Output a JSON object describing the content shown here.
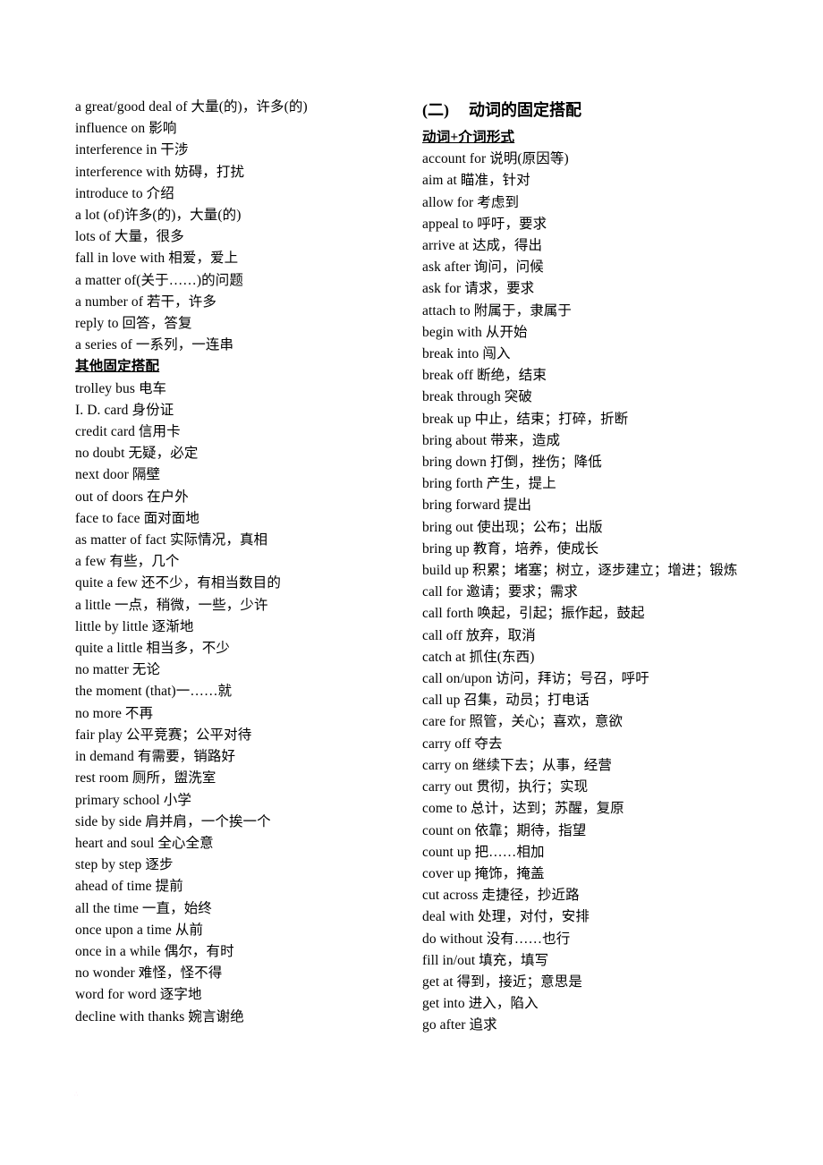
{
  "left_column": {
    "blocks": [
      {
        "type": "entries",
        "items": [
          "a great/good deal of 大量(的)，许多(的)",
          "influence on 影响",
          "interference in 干涉",
          "interference with 妨碍，打扰",
          "introduce to 介绍",
          "a lot (of)许多(的)，大量(的)",
          "lots of 大量，很多",
          "fall in love with 相爱，爱上",
          "a matter of(关于……)的问题",
          "a number of 若干，许多",
          "reply to 回答，答复",
          "a series of 一系列，一连串"
        ]
      },
      {
        "type": "section_head",
        "title": "其他固定搭配 "
      },
      {
        "type": "entries",
        "items": [
          "trolley bus 电车",
          "I. D. card 身份证",
          "credit card 信用卡",
          "no doubt 无疑，必定",
          "next door 隔壁",
          "out of doors 在户外",
          "face to face 面对面地",
          "as matter of fact 实际情况，真相",
          "a few 有些，几个",
          "quite a few 还不少，有相当数目的",
          "a little 一点，稍微，一些，少许",
          "little by little 逐渐地",
          "quite a little 相当多，不少",
          "no matter 无论",
          "the moment (that)一……就",
          "no more 不再",
          "fair play 公平竞赛；公平对待",
          "in demand 有需要，销路好",
          "rest room 厕所，盥洗室",
          "primary school 小学",
          "side by side 肩并肩，一个挨一个",
          "heart and soul 全心全意",
          "step by step 逐步",
          "ahead of time 提前",
          "all the time 一直，始终",
          "once upon a time 从前",
          "once in a while 偶尔，有时",
          "no wonder  难怪，怪不得",
          "word for word 逐字地",
          "decline with thanks 婉言谢绝"
        ]
      }
    ]
  },
  "right_column": {
    "chapter": {
      "number": "(二)",
      "title": "动词的固定搭配"
    },
    "blocks": [
      {
        "type": "section_head",
        "title": "动词+介词形式 "
      },
      {
        "type": "entries",
        "items": [
          "account for 说明(原因等)",
          "aim at 瞄准，针对",
          "allow for 考虑到",
          "appeal to 呼吁，要求",
          "arrive at 达成，得出",
          "ask after 询问，问候",
          "ask for 请求，要求",
          "attach to 附属于，隶属于",
          "begin with 从开始",
          "break into 闯入",
          "break off 断绝，结束",
          "break through 突破",
          "break up 中止，结束；打碎，折断",
          "bring about 带来，造成",
          "bring down 打倒，挫伤；降低",
          "bring forth 产生，提上",
          "bring forward 提出",
          "bring out 使出现；公布；出版",
          "bring up 教育，培养，使成长",
          "build up 积累；堵塞；树立，逐步建立；增进；锻炼",
          "call for 邀请；要求；需求",
          "call forth 唤起，引起；振作起，鼓起",
          "call off 放弃，取消",
          "catch at 抓住(东西)",
          "call on/upon 访问，拜访；号召，呼吁",
          "call up 召集，动员；打电话",
          "care for 照管，关心；喜欢，意欲",
          "carry off 夺去",
          "carry on 继续下去；从事，经营",
          "carry out 贯彻，执行；实现",
          "come to 总计，达到；苏醒，复原",
          "count on 依靠；期待，指望",
          "count up 把……相加",
          "cover up 掩饰，掩盖",
          "cut across 走捷径，抄近路",
          "deal with 处理，对付，安排",
          "do without 没有……也行",
          "fill in/out 填充，填写",
          "get at 得到，接近；意思是",
          "get into 进入，陷入",
          "go after 追求"
        ]
      }
    ]
  },
  "artifact": {
    "mark": "∴"
  }
}
